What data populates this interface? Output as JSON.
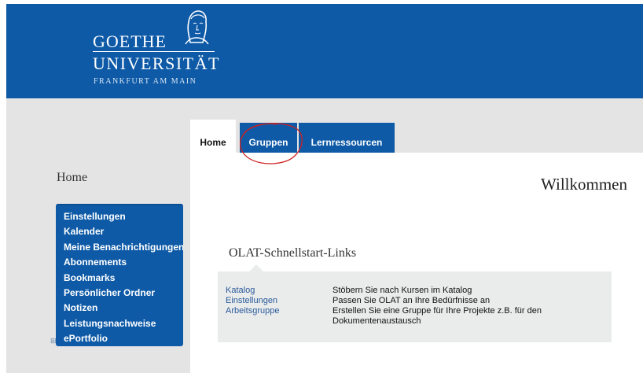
{
  "brand": {
    "name": "GOETHE",
    "university": "UNIVERSITÄT",
    "city": "FRANKFURT AM MAIN",
    "header_color": "#0e5aa7"
  },
  "tabs": [
    {
      "label": "Home",
      "active": true
    },
    {
      "label": "Gruppen",
      "active": false
    },
    {
      "label": "Lernressourcen",
      "active": false
    }
  ],
  "sidebar": {
    "title": "Home",
    "items": [
      {
        "label": "Einstellungen"
      },
      {
        "label": "Kalender"
      },
      {
        "label": "Meine Benachrichtigungen"
      },
      {
        "label": "Abonnements"
      },
      {
        "label": "Bookmarks"
      },
      {
        "label": "Persönlicher Ordner"
      },
      {
        "label": "Notizen"
      },
      {
        "label": "Leistungsnachweise"
      },
      {
        "label": "ePortfolio"
      }
    ],
    "expand_symbol": "⊞"
  },
  "main": {
    "welcome": "Willkommen",
    "links_title": "OLAT-Schnellstart-Links",
    "links": [
      {
        "label": "Katalog",
        "desc": "Stöbern Sie nach Kursen im Katalog"
      },
      {
        "label": "Einstellungen",
        "desc": "Passen Sie OLAT an Ihre Bedürfnisse an"
      },
      {
        "label": "Arbeitsgruppe",
        "desc": "Erstellen Sie eine Gruppe für Ihre Projekte z.B. für den Dokumentenaustausch"
      }
    ]
  },
  "annotation": {
    "color": "#d02020",
    "target": "Gruppen"
  }
}
